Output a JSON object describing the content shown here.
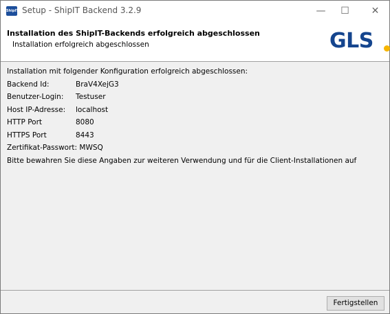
{
  "window": {
    "title": "Setup - ShipIT Backend 3.2.9",
    "app_icon_text": "ShipIT",
    "minimize_glyph": "—",
    "maximize_glyph": "☐",
    "close_glyph": "✕"
  },
  "header": {
    "title": "Installation des ShipIT-Backends erfolgreich abgeschlossen",
    "subtitle": "Installation erfolgreich abgeschlossen",
    "logo_text": "GLS",
    "logo_color": "#15458e",
    "logo_dot_color": "#f7b500"
  },
  "content": {
    "intro": "Installation mit folgender Konfiguration erfolgreich abgeschlossen:",
    "rows": [
      {
        "label": "Backend Id:",
        "value": "BraV4XejG3"
      },
      {
        "label": "Benutzer-Login:",
        "value": "Testuser"
      },
      {
        "label": "Host IP-Adresse:",
        "value": "localhost"
      },
      {
        "label": "HTTP Port",
        "value": "8080"
      },
      {
        "label": "HTTPS Port",
        "value": "8443"
      }
    ],
    "password_line": "Zertifikat-Passwort: MWSQ",
    "note": "Bitte bewahren Sie diese Angaben zur weiteren Verwendung und für die Client-Installationen auf"
  },
  "footer": {
    "finish_label": "Fertigstellen"
  }
}
